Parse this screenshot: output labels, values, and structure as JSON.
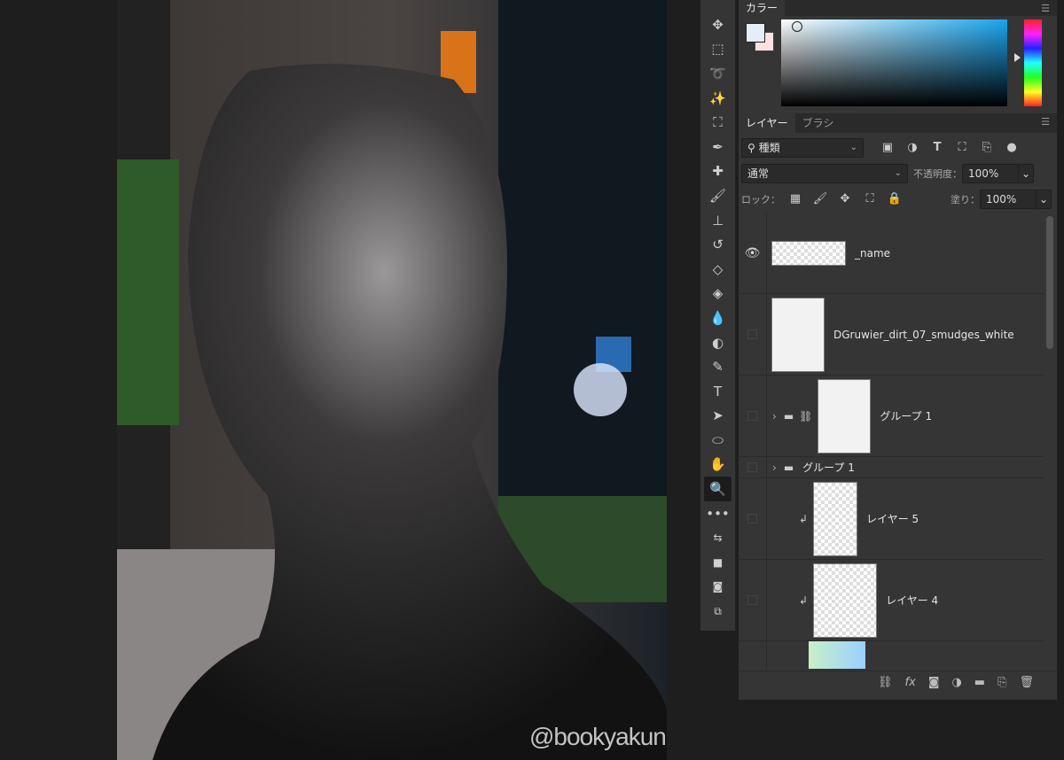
{
  "canvas": {
    "watermark": "@bookyakuno"
  },
  "toolbar": {
    "tools": [
      {
        "name": "move-tool",
        "glyph": "✥"
      },
      {
        "name": "marquee-tool",
        "glyph": "⬚"
      },
      {
        "name": "lasso-tool",
        "glyph": "➰"
      },
      {
        "name": "magic-wand-tool",
        "glyph": "✨"
      },
      {
        "name": "crop-tool",
        "glyph": "⛶"
      },
      {
        "name": "eyedropper-tool",
        "glyph": "✒"
      },
      {
        "name": "healing-tool",
        "glyph": "✚"
      },
      {
        "name": "brush-tool",
        "glyph": "🖌"
      },
      {
        "name": "stamp-tool",
        "glyph": "⊥"
      },
      {
        "name": "history-brush-tool",
        "glyph": "↺"
      },
      {
        "name": "eraser-tool",
        "glyph": "◇"
      },
      {
        "name": "paint-bucket-tool",
        "glyph": "◈"
      },
      {
        "name": "blur-tool",
        "glyph": "💧"
      },
      {
        "name": "dodge-tool",
        "glyph": "◐"
      },
      {
        "name": "pen-tool",
        "glyph": "✎"
      },
      {
        "name": "type-tool",
        "glyph": "T"
      },
      {
        "name": "path-select-tool",
        "glyph": "➤"
      },
      {
        "name": "ellipse-tool",
        "glyph": "⬭"
      },
      {
        "name": "hand-tool",
        "glyph": "✋"
      },
      {
        "name": "zoom-tool",
        "glyph": "🔍"
      },
      {
        "name": "more-tools",
        "glyph": "•••"
      },
      {
        "name": "swap-colors",
        "glyph": "⇆"
      },
      {
        "name": "color-swatches",
        "glyph": "■"
      },
      {
        "name": "quick-mask",
        "glyph": "◙"
      },
      {
        "name": "screen-mode",
        "glyph": "⧉"
      }
    ]
  },
  "color_panel": {
    "tab": "カラー",
    "foreground": "#e3eef6",
    "background": "#fde1e3"
  },
  "layers_panel": {
    "tabs": [
      "レイヤー",
      "ブラシ"
    ],
    "filter": "種類",
    "blend_mode": "通常",
    "opacity_label": "不透明度：",
    "opacity": "100%",
    "lock_label": "ロック：",
    "fill_label": "塗り：",
    "fill": "100%",
    "layers": [
      {
        "name": "_name",
        "visible": true
      },
      {
        "name": "DGruwier_dirt_07_smudges_white",
        "visible": false
      },
      {
        "name": "グループ 1",
        "visible": false
      },
      {
        "name": "グループ 1",
        "visible": false
      },
      {
        "name": "レイヤー 5",
        "visible": false
      },
      {
        "name": "レイヤー 4",
        "visible": false
      }
    ],
    "bottom": [
      "link",
      "fx",
      "mask",
      "adjustment",
      "group",
      "new-layer",
      "delete"
    ]
  }
}
